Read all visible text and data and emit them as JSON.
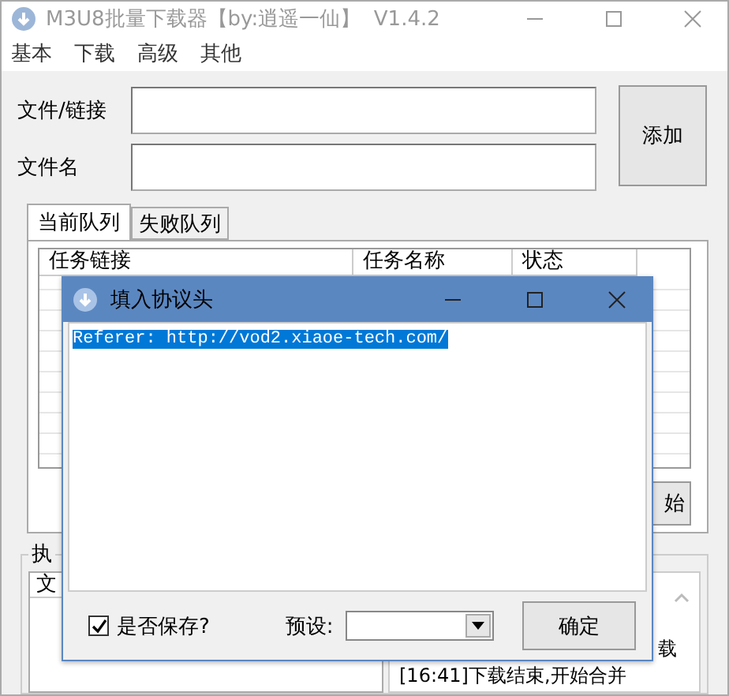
{
  "window": {
    "title": "M3U8批量下载器【by:逍遥一仙】  V1.4.2"
  },
  "menu": [
    "基本",
    "下载",
    "高级",
    "其他"
  ],
  "fields": [
    {
      "label": "文件/链接"
    },
    {
      "label": "文件名"
    }
  ],
  "add_button": "添加",
  "tabs": [
    {
      "label": "当前队列",
      "selected": true
    },
    {
      "label": "失败队列",
      "selected": false
    }
  ],
  "table": {
    "columns": [
      "任务链接",
      "任务名称",
      "状态"
    ]
  },
  "start_button": "始",
  "group": {
    "title": "执",
    "list_columns": [
      "文"
    ],
    "log_lines": [
      "载",
      "[16:41]下载结束,开始合并"
    ]
  },
  "dialog": {
    "title": "填入协议头",
    "header_text": "Referer: http://vod2.xiaoe-tech.com/",
    "text_selected": true,
    "save_checkbox": {
      "label": "是否保存?",
      "checked": true
    },
    "preset_label": "预设:",
    "ok_button": "确定"
  }
}
